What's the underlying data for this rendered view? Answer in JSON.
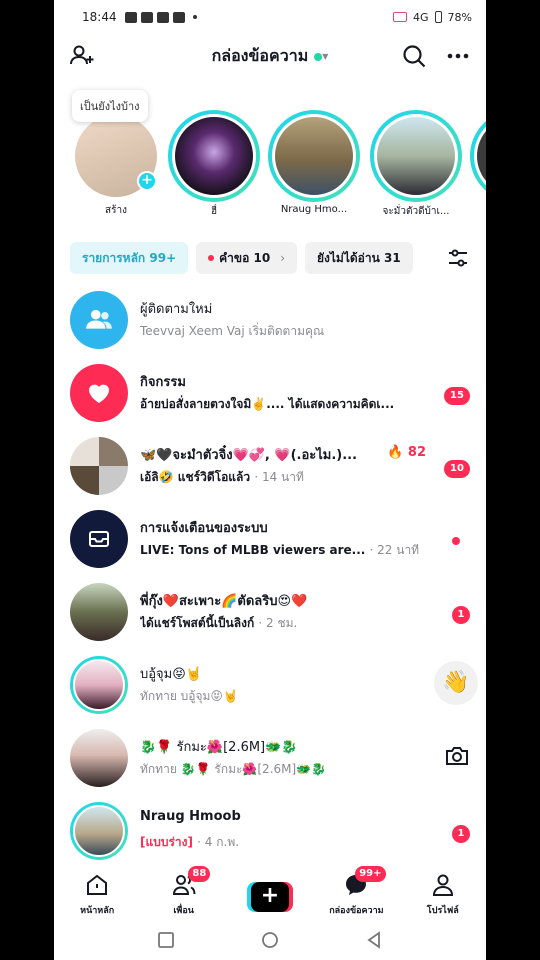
{
  "status_bar": {
    "time": "18:44",
    "network": "4G",
    "battery": "78%"
  },
  "header": {
    "title": "กล่องข้อความ"
  },
  "stories": {
    "bubble_text": "เป็นยังไงบ้าง",
    "items": [
      {
        "label": "สร้าง"
      },
      {
        "label": "ฮื่"
      },
      {
        "label": "Nraug Hmo..."
      },
      {
        "label": "จะมั่วตัวดีบ้าเ..."
      }
    ]
  },
  "tabs": [
    {
      "label": "รายการหลัก 99+"
    },
    {
      "label": "คำขอ 10"
    },
    {
      "label": "ยังไม่ได้อ่าน 31"
    }
  ],
  "conversations": [
    {
      "name": "ผู้ติดตามใหม่",
      "preview": "Teevvaj Xeem Vaj เริ่มติดตามคุณ",
      "time": "",
      "badge": ""
    },
    {
      "name": "กิจกรรม",
      "preview": "อ้ายบ่อสั่งลายตวงใจมิ✌️.... ได้แสดงความคิดเ...",
      "time": "",
      "badge": "15"
    },
    {
      "name": "🦋🖤จะมำตัวจิ๋ง💗💞, 💗(.อะไม.)...",
      "preview": "เอ้ลิ🤣 แชร์วิดีโอแล้ว",
      "time": "· 14 นาที",
      "badge": "10",
      "streak": "🔥 82"
    },
    {
      "name": "การแจ้งเตือนของระบบ",
      "preview": "LIVE: Tons of MLBB viewers are...",
      "time": "· 22 นาที",
      "badge": ""
    },
    {
      "name": "พี่กุ๊ง❤️สะเพาะ🌈ตัดลริบ😍❤️",
      "preview": "ได้แชร์โพสต์นี้เป็นลิงก์",
      "time": "· 2 ชม.",
      "badge": "1"
    },
    {
      "name": "บอู้จุม😝🤘",
      "preview": "ทักทาย บอู้จุม😝🤘",
      "time": "",
      "badge": ""
    },
    {
      "name": "🐉🌹 รักมะ🌺[2.6M]🐲🐉",
      "preview": "ทักทาย 🐉🌹 รักมะ🌺[2.6M]🐲🐉",
      "time": "",
      "badge": ""
    },
    {
      "name": "Nraug Hmoob",
      "preview": "[แบบร่าง]",
      "time": "· 4 ก.พ.",
      "badge": "1"
    }
  ],
  "bottom_nav": {
    "home": "หน้าหลัก",
    "friends": "เพื่อน",
    "friends_badge": "88",
    "inbox": "กล่องข้อความ",
    "inbox_badge": "99+",
    "profile": "โปรไฟล์"
  },
  "colors": {
    "accent_cyan": "#20d5ec",
    "accent_pink": "#fe2c55"
  }
}
